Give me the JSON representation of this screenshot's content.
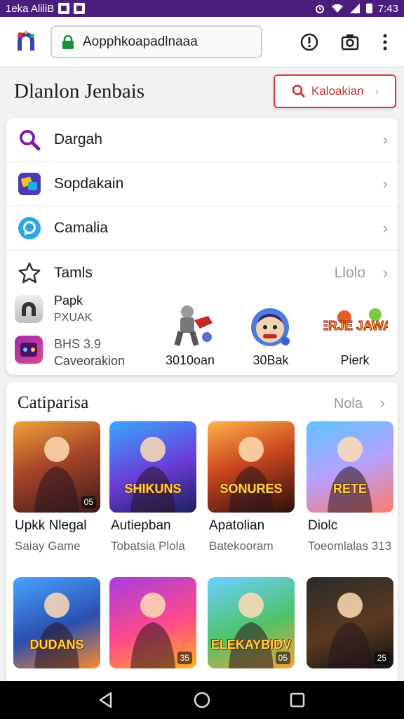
{
  "status": {
    "left_text": "1eka AliliB",
    "time": "7:43"
  },
  "browser": {
    "url": "Aopphkoapadlnaaa"
  },
  "page": {
    "title": "Dlanlon Jenbais",
    "search_button_label": "Kaloakian"
  },
  "menu": {
    "items": [
      {
        "label": "Dargah",
        "icon": "search-icon"
      },
      {
        "label": "Sopdakain",
        "icon": "puzzle-app-icon"
      },
      {
        "label": "Camalia",
        "icon": "chat-icon"
      },
      {
        "label": "Tamls",
        "icon": "star-icon",
        "more": "Llolo"
      }
    ]
  },
  "featured": {
    "left": [
      {
        "name": "Papk",
        "sub": "PXUAK",
        "icon": "arch-app-icon"
      },
      {
        "name": "BHS 3.9",
        "sub": "Caveorakion",
        "icon": "game-app-icon"
      }
    ],
    "apps": [
      {
        "label": "3010oan",
        "icon": "robot-character-icon"
      },
      {
        "label": "30Bak",
        "icon": "cartoon-face-icon"
      },
      {
        "label": "Pierk",
        "icon": "game-logo-icon",
        "logo_text": "BERJE JAWAS"
      }
    ]
  },
  "section": {
    "title": "Catiparisa",
    "more": "Nola",
    "games": [
      {
        "name": "Upkk Nlegal",
        "sub": "Saiay Game",
        "badge": "05",
        "art": "warrior",
        "title_art": ""
      },
      {
        "name": "Autiepban",
        "sub": "Tobatsia Plola",
        "badge": "",
        "art": "hero",
        "title_art": "SHIKUNS"
      },
      {
        "name": "Apatolian",
        "sub": "Batekooram",
        "badge": "",
        "art": "woman",
        "title_art": "SONURES"
      },
      {
        "name": "Diolc",
        "sub": "Toeomlalas 313",
        "badge": "",
        "art": "cartoon",
        "title_art": "RETE"
      },
      {
        "name": "",
        "sub": "",
        "badge": "",
        "art": "squad",
        "title_art": "DUDANS"
      },
      {
        "name": "",
        "sub": "",
        "badge": "35",
        "art": "flame",
        "title_art": ""
      },
      {
        "name": "",
        "sub": "",
        "badge": "05",
        "art": "kids",
        "title_art": "ELEKAYBIDV"
      },
      {
        "name": "",
        "sub": "",
        "badge": "25",
        "art": "wolf",
        "title_art": ""
      }
    ]
  },
  "colors": {
    "status_bar": "#4b1e7e",
    "accent_red": "#e03a3a",
    "search_purple": "#7a1fa2"
  }
}
